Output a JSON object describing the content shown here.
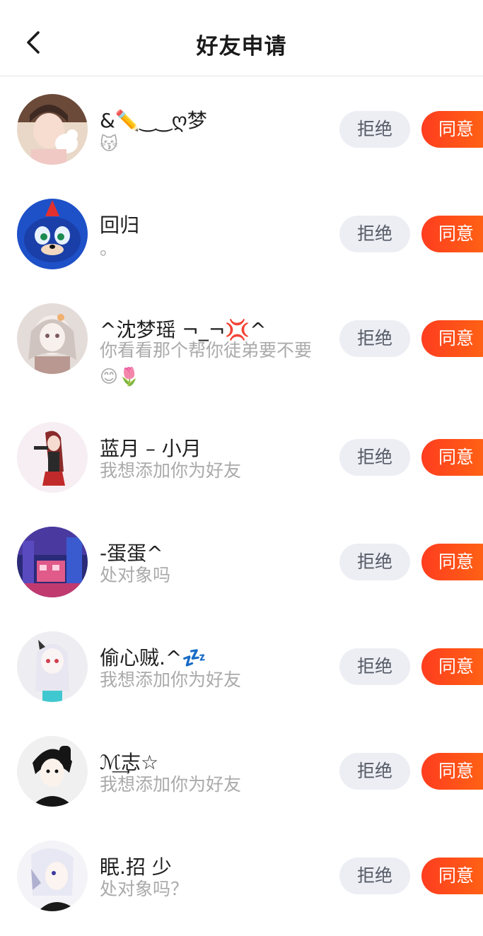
{
  "header": {
    "title": "好友申请",
    "back_icon": "chevron-left-icon"
  },
  "actions": {
    "reject_label": "拒绝",
    "accept_label": "同意"
  },
  "requests": [
    {
      "name": "&✏️‿‿ღ梦",
      "message": "😽"
    },
    {
      "name": "回归",
      "message": "。"
    },
    {
      "name": "^沈梦瑶 ¬_¬💢^",
      "message": "你看看那个帮你徒弟要不要😊🌷"
    },
    {
      "name": "蓝月 – 小月",
      "message": "我想添加你为好友"
    },
    {
      "name": "-蛋蛋^",
      "message": "处对象吗"
    },
    {
      "name": "偷心贼.^💤",
      "message": "我想添加你为好友"
    },
    {
      "name": "ℳ͢志☆",
      "message": "我想添加你为好友"
    },
    {
      "name": "眠.招  少",
      "message": "处对象吗？"
    }
  ],
  "colors": {
    "accent": "#ff5014",
    "reject_bg": "#eceef4",
    "secondary_text": "#aaaaaa"
  }
}
